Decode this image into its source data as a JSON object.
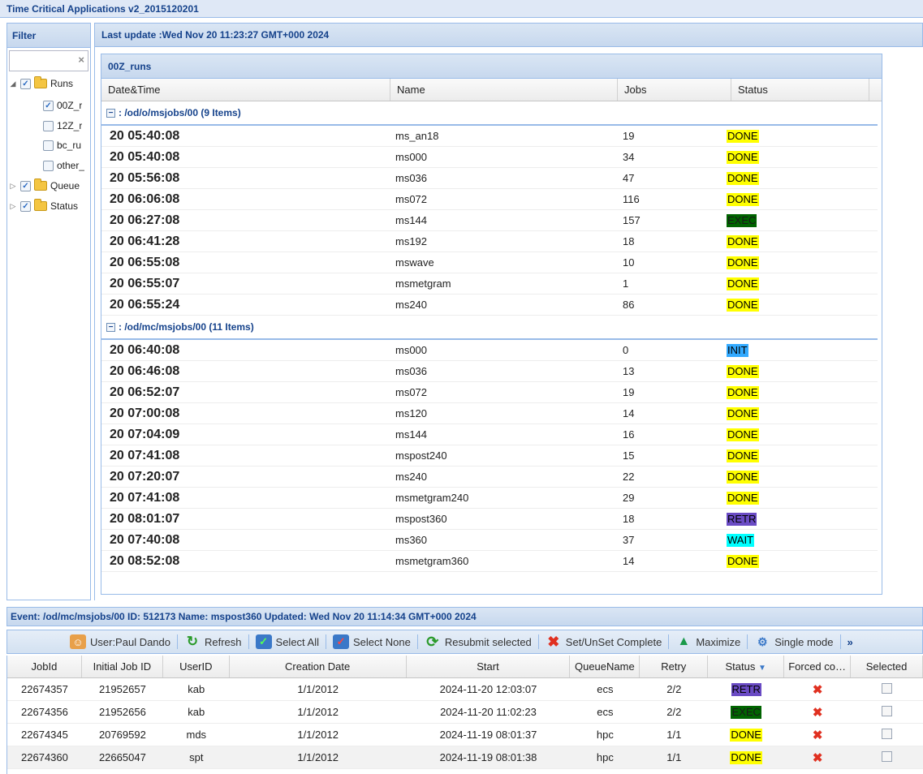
{
  "app_title": "Time Critical Applications v2_2015120201",
  "filter": {
    "title": "Filter",
    "search_value": "",
    "tree": [
      {
        "label": "Runs",
        "checked": true,
        "expanded": true
      },
      {
        "label": "00Z_r",
        "checked": true
      },
      {
        "label": "12Z_r",
        "checked": false
      },
      {
        "label": "bc_ru",
        "checked": false
      },
      {
        "label": "other_",
        "checked": false
      },
      {
        "label": "Queue",
        "checked": true,
        "expanded": false
      },
      {
        "label": "Status",
        "checked": true,
        "expanded": false
      }
    ]
  },
  "main": {
    "last_update": "Last update :Wed Nov 20 11:23:27 GMT+000 2024",
    "grid_title": "00Z_runs",
    "columns": [
      "Date&Time",
      "Name",
      "Jobs",
      "Status"
    ],
    "groups": [
      {
        "label": ": /od/o/msjobs/00 (9 Items)",
        "rows": [
          {
            "time": "20 05:40:08",
            "name": "ms_an18",
            "jobs": "19",
            "status": "DONE"
          },
          {
            "time": "20 05:40:08",
            "name": "ms000",
            "jobs": "34",
            "status": "DONE"
          },
          {
            "time": "20 05:56:08",
            "name": "ms036",
            "jobs": "47",
            "status": "DONE"
          },
          {
            "time": "20 06:06:08",
            "name": "ms072",
            "jobs": "116",
            "status": "DONE"
          },
          {
            "time": "20 06:27:08",
            "name": "ms144",
            "jobs": "157",
            "status": "EXEC"
          },
          {
            "time": "20 06:41:28",
            "name": "ms192",
            "jobs": "18",
            "status": "DONE"
          },
          {
            "time": "20 06:55:08",
            "name": "mswave",
            "jobs": "10",
            "status": "DONE"
          },
          {
            "time": "20 06:55:07",
            "name": "msmetgram",
            "jobs": "1",
            "status": "DONE"
          },
          {
            "time": "20 06:55:24",
            "name": "ms240",
            "jobs": "86",
            "status": "DONE"
          }
        ]
      },
      {
        "label": ": /od/mc/msjobs/00 (11 Items)",
        "rows": [
          {
            "time": "20 06:40:08",
            "name": "ms000",
            "jobs": "0",
            "status": "INIT"
          },
          {
            "time": "20 06:46:08",
            "name": "ms036",
            "jobs": "13",
            "status": "DONE"
          },
          {
            "time": "20 06:52:07",
            "name": "ms072",
            "jobs": "19",
            "status": "DONE"
          },
          {
            "time": "20 07:00:08",
            "name": "ms120",
            "jobs": "14",
            "status": "DONE"
          },
          {
            "time": "20 07:04:09",
            "name": "ms144",
            "jobs": "16",
            "status": "DONE"
          },
          {
            "time": "20 07:41:08",
            "name": "mspost240",
            "jobs": "15",
            "status": "DONE"
          },
          {
            "time": "20 07:20:07",
            "name": "ms240",
            "jobs": "22",
            "status": "DONE"
          },
          {
            "time": "20 07:41:08",
            "name": "msmetgram240",
            "jobs": "29",
            "status": "DONE"
          },
          {
            "time": "20 08:01:07",
            "name": "mspost360",
            "jobs": "18",
            "status": "RETR"
          },
          {
            "time": "20 07:40:08",
            "name": "ms360",
            "jobs": "37",
            "status": "WAIT"
          },
          {
            "time": "20 08:52:08",
            "name": "msmetgram360",
            "jobs": "14",
            "status": "DONE"
          }
        ]
      }
    ]
  },
  "event": "Event: /od/mc/msjobs/00 ID: 512173 Name: mspost360 Updated: Wed Nov 20 11:14:34 GMT+000 2024",
  "toolbar": {
    "user": "User:Paul Dando",
    "refresh": "Refresh",
    "select_all": "Select All",
    "select_none": "Select None",
    "resubmit": "Resubmit selected",
    "set_unset": "Set/UnSet Complete",
    "maximize": "Maximize",
    "single_mode": "Single mode",
    "more": "»"
  },
  "jobs": {
    "columns": [
      "JobId",
      "Initial Job ID",
      "UserID",
      "Creation Date",
      "Start",
      "QueueName",
      "Retry",
      "Status",
      "Forced co…",
      "Selected"
    ],
    "rows": [
      {
        "jobid": "22674357",
        "initial": "21952657",
        "user": "kab",
        "created": "1/1/2012",
        "start": "2024-11-20 12:03:07",
        "queue": "ecs",
        "retry": "2/2",
        "status": "RETR"
      },
      {
        "jobid": "22674356",
        "initial": "21952656",
        "user": "kab",
        "created": "1/1/2012",
        "start": "2024-11-20 11:02:23",
        "queue": "ecs",
        "retry": "2/2",
        "status": "EXEC"
      },
      {
        "jobid": "22674345",
        "initial": "20769592",
        "user": "mds",
        "created": "1/1/2012",
        "start": "2024-11-19 08:01:37",
        "queue": "hpc",
        "retry": "1/1",
        "status": "DONE"
      },
      {
        "jobid": "22674360",
        "initial": "22665047",
        "user": "spt",
        "created": "1/1/2012",
        "start": "2024-11-19 08:01:38",
        "queue": "hpc",
        "retry": "1/1",
        "status": "DONE"
      }
    ]
  }
}
